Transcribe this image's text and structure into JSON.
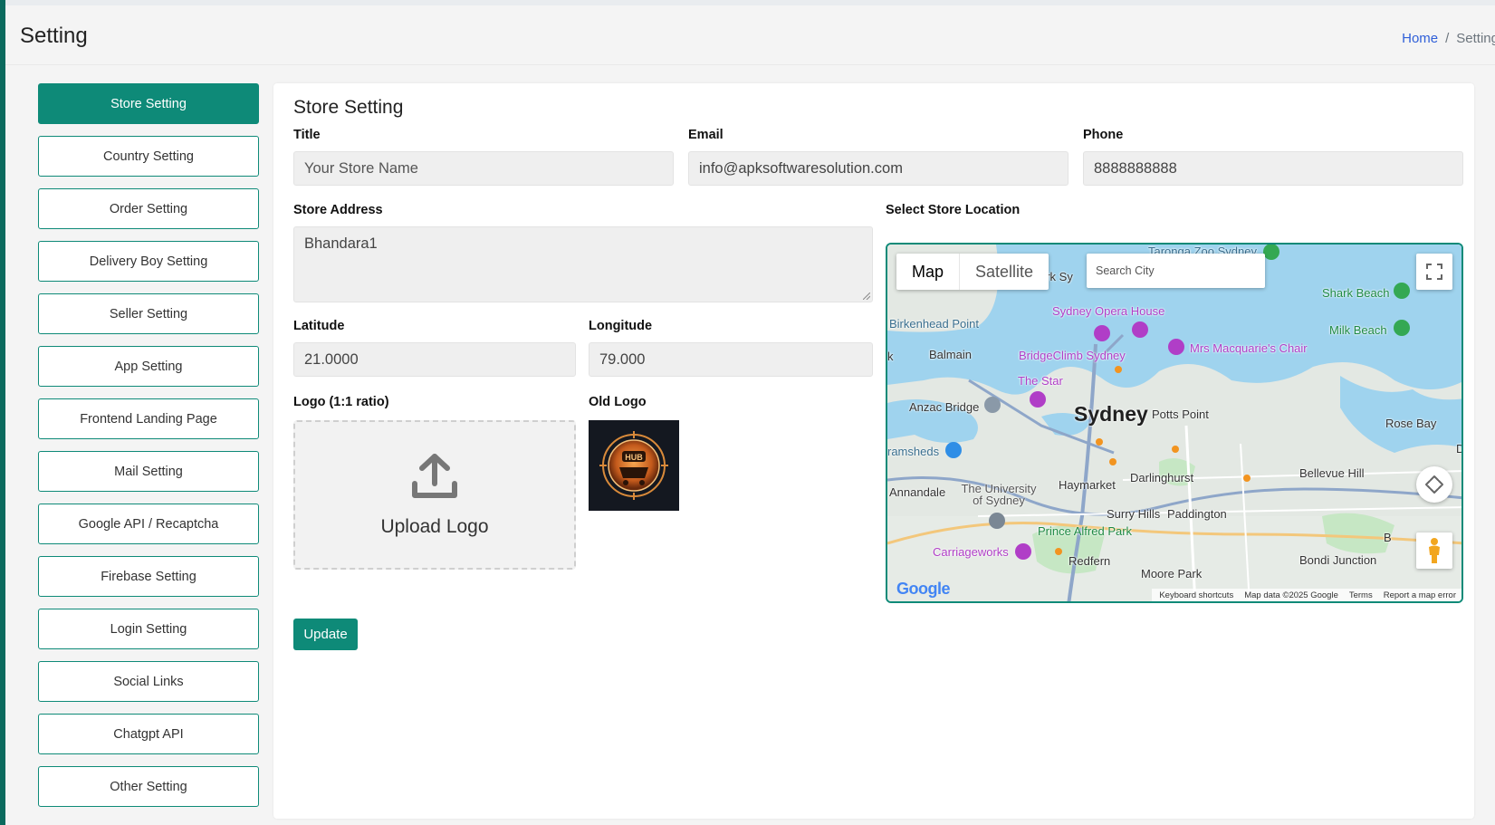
{
  "header": {
    "title": "Setting",
    "breadcrumb": {
      "home": "Home",
      "separator": "/",
      "current": "Setting"
    }
  },
  "sidebar": {
    "items": [
      {
        "label": "Store Setting",
        "active": true
      },
      {
        "label": "Country Setting"
      },
      {
        "label": "Order Setting"
      },
      {
        "label": "Delivery Boy Setting"
      },
      {
        "label": "Seller Setting"
      },
      {
        "label": "App Setting"
      },
      {
        "label": "Frontend Landing Page"
      },
      {
        "label": "Mail Setting"
      },
      {
        "label": "Google API / Recaptcha"
      },
      {
        "label": "Firebase Setting"
      },
      {
        "label": "Login Setting"
      },
      {
        "label": "Social Links"
      },
      {
        "label": "Chatgpt API"
      },
      {
        "label": "Other Setting"
      }
    ]
  },
  "form": {
    "heading": "Store Setting",
    "title": {
      "label": "Title",
      "placeholder": "Your Store Name"
    },
    "email": {
      "label": "Email",
      "value": "info@apksoftwaresolution.com"
    },
    "phone": {
      "label": "Phone",
      "value": "8888888888"
    },
    "address": {
      "label": "Store Address",
      "value": "Bhandara1"
    },
    "latitude": {
      "label": "Latitude",
      "value": "21.0000"
    },
    "longitude": {
      "label": "Longitude",
      "value": "79.000"
    },
    "logo": {
      "label": "Logo (1:1 ratio)",
      "upload_text": "Upload Logo"
    },
    "old_logo": {
      "label": "Old Logo",
      "logo_text": "HUB"
    },
    "update_button": "Update"
  },
  "map": {
    "label": "Select Store Location",
    "type_map": "Map",
    "type_satellite": "Satellite",
    "search_placeholder": "Search City",
    "places": {
      "sydney": "Sydney",
      "potts_point": "Potts Point",
      "opera_house": "Sydney Opera House",
      "birkenhead": "Birkenhead Point",
      "balmain": "Balmain",
      "bridgeclimb": "BridgeClimb Sydney",
      "macquarie": "Mrs Macquarie's Chair",
      "the_star": "The Star",
      "anzac": "Anzac Bridge",
      "shark_beach": "Shark Beach",
      "milk_beach": "Milk Beach",
      "rose_bay": "Rose Bay",
      "bellevue": "Bellevue Hill",
      "darlinghurst": "Darlinghurst",
      "haymarket": "Haymarket",
      "annandale": "Annandale",
      "university": "The University of Sydney",
      "surry_hills": "Surry Hills",
      "paddington": "Paddington",
      "prince_alfred": "Prince Alfred Park",
      "carriageworks": "Carriageworks",
      "redfern": "Redfern",
      "bondi_junction": "Bondi Junction",
      "moore_park": "Moore Park",
      "taronga": "Taronga Zoo Sydney",
      "park_sy": "ark Sy",
      "tramsheds": "ramsheds",
      "k": "k",
      "d": "D",
      "b": "B"
    },
    "google": "Google",
    "footer": {
      "shortcuts": "Keyboard shortcuts",
      "data": "Map data ©2025 Google",
      "terms": "Terms",
      "report": "Report a map error"
    }
  },
  "colors": {
    "accent": "#0e8a78",
    "sidebar_stripe": "#0b6a5e",
    "link": "#2f5fd8"
  }
}
